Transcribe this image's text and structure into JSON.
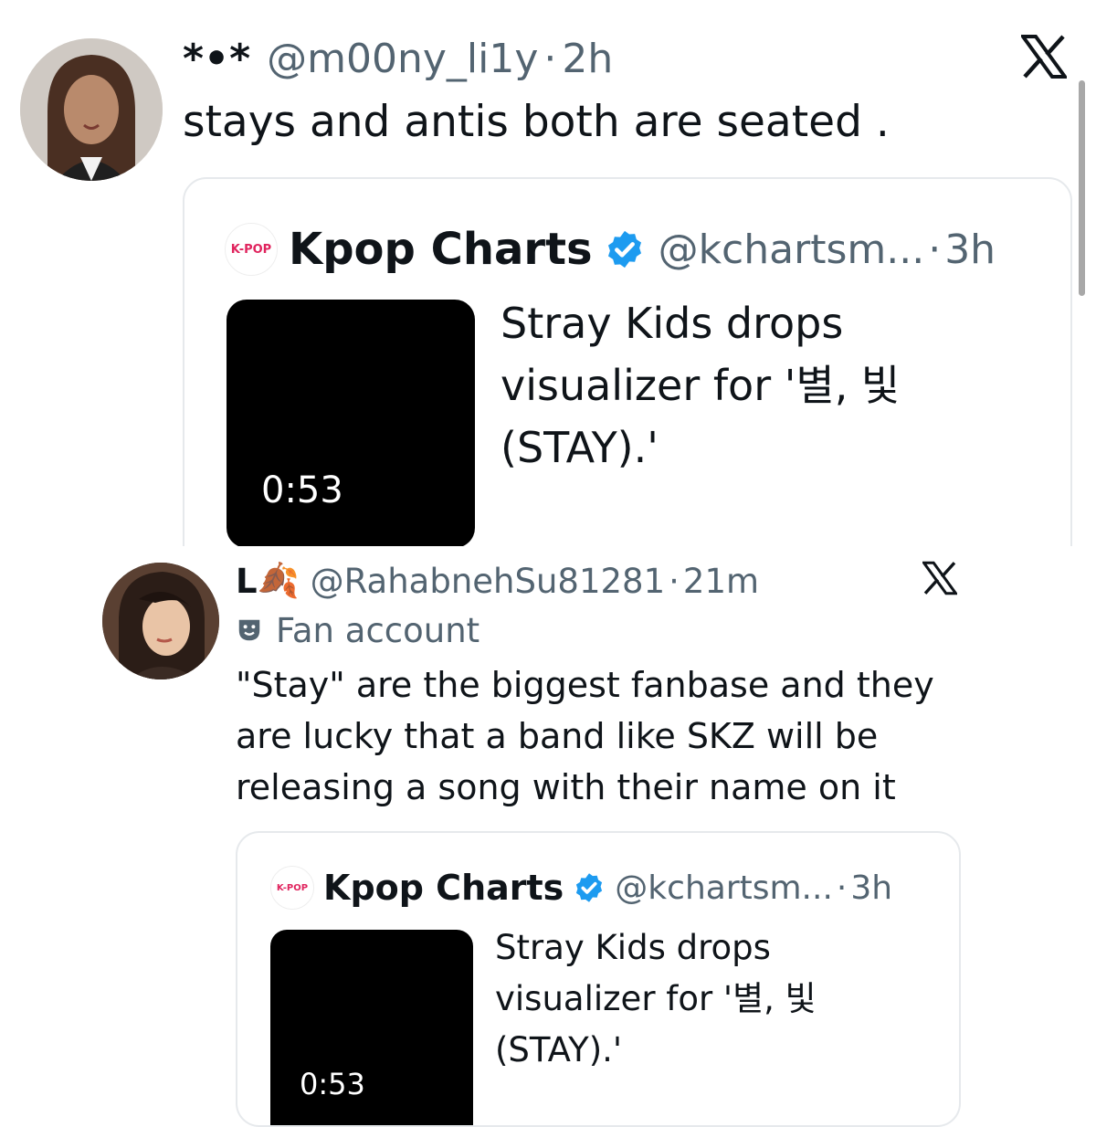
{
  "tweet1": {
    "display_name": "*•*",
    "handle": "@m00ny_li1y",
    "sep": "·",
    "time": "2h",
    "text": "stays and antis both are seated .",
    "quote": {
      "logo_text": "K-POP",
      "name": "Kpop Charts",
      "handle": "@kchartsm...",
      "sep": "·",
      "time": "3h",
      "duration": "0:53",
      "text_lines": [
        "Stray Kids drops",
        "visualizer for '별, 빛",
        "(STAY).'"
      ]
    }
  },
  "tweet2": {
    "display_name": "L",
    "name_emoji": "🍂",
    "handle": "@RahabnehSu81281",
    "sep": "·",
    "time": "21m",
    "label": "Fan account",
    "text_lines": [
      "\"Stay\" are the biggest fanbase and they",
      "are lucky that a band like SKZ will be",
      "releasing a song with their name on it"
    ],
    "quote": {
      "logo_text": "K-POP",
      "name": "Kpop Charts",
      "handle": "@kchartsm...",
      "sep": "·",
      "time": "3h",
      "duration": "0:53",
      "text_lines": [
        "Stray Kids drops",
        "visualizer for '별, 빛",
        "(STAY).'"
      ]
    }
  },
  "icons": {
    "x_logo": "x-logo-icon",
    "verified": "verified-badge-icon",
    "fan_label": "theater-mask-icon"
  },
  "colors": {
    "verified_blue": "#1d9bf0",
    "muted": "#536471",
    "text": "#0f1419"
  }
}
